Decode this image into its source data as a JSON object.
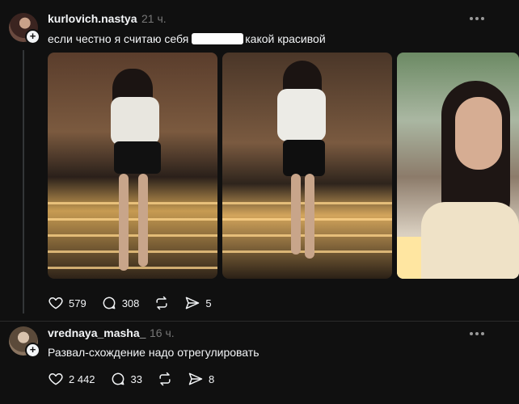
{
  "post1": {
    "username": "kurlovich.nastya",
    "time": "21 ч.",
    "text": "если честно я считаю себя ",
    "text_hidden": "",
    "text_end": "какой красивой",
    "photos": [
      "photo-1",
      "photo-2",
      "photo-3"
    ],
    "likes": "579",
    "comments": "308",
    "shares": "5"
  },
  "post2": {
    "username": "vrednaya_masha_",
    "time": "16 ч.",
    "text": "Развал-схождение надо отрегулировать",
    "likes": "2 442",
    "comments": "33",
    "shares": "8"
  },
  "icons": {
    "like": "heart-icon",
    "comment": "comment-icon",
    "repost": "repost-icon",
    "share": "send-icon",
    "more": "more-icon",
    "follow": "plus-icon"
  },
  "colors": {
    "background": "#101010",
    "text": "#f3f5f7",
    "muted": "#777777",
    "redaction": "#ffffff"
  }
}
